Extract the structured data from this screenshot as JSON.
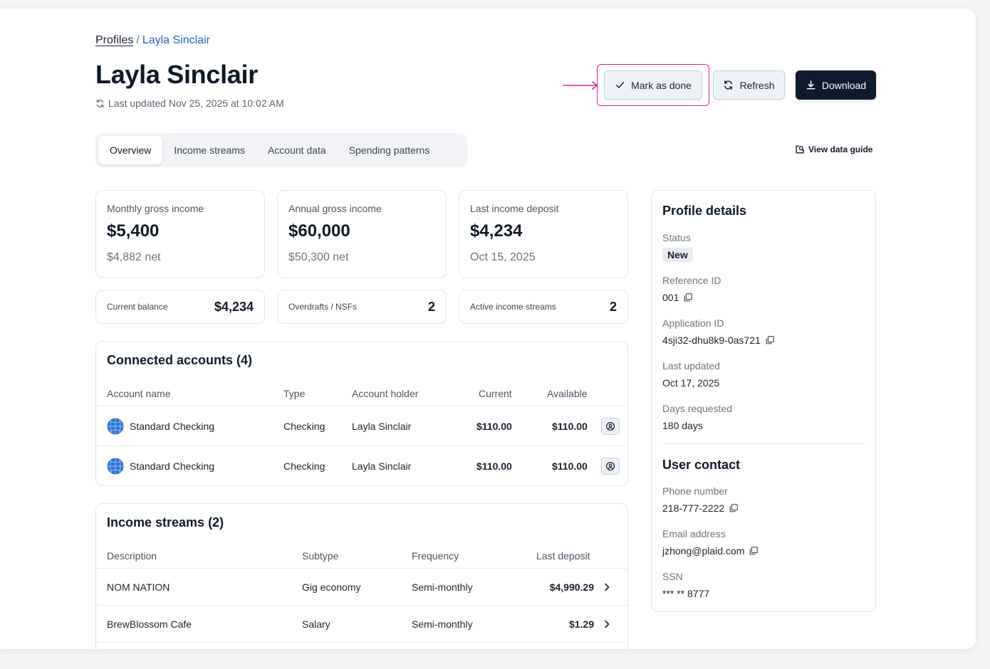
{
  "breadcrumb": {
    "root": "Profiles",
    "separator": "/",
    "current": "Layla Sinclair"
  },
  "header": {
    "title": "Layla Sinclair",
    "last_updated": "Last updated Nov 25, 2025 at 10:02 AM"
  },
  "actions": {
    "mark_done": "Mark as done",
    "refresh": "Refresh",
    "download": "Download"
  },
  "tabs": [
    {
      "label": "Overview",
      "active": true
    },
    {
      "label": "Income streams",
      "active": false
    },
    {
      "label": "Account data",
      "active": false
    },
    {
      "label": "Spending patterns",
      "active": false
    }
  ],
  "guide_link": "View data guide",
  "stats": [
    {
      "label": "Monthly gross income",
      "value": "$5,400",
      "sub": "$4,882 net"
    },
    {
      "label": "Annual gross income",
      "value": "$60,000",
      "sub": "$50,300 net"
    },
    {
      "label": "Last income deposit",
      "value": "$4,234",
      "sub": "Oct 15, 2025"
    }
  ],
  "mini_stats": [
    {
      "label": "Current balance",
      "value": "$4,234"
    },
    {
      "label": "Overdrafts / NSFs",
      "value": "2"
    },
    {
      "label": "Active income streams",
      "value": "2"
    }
  ],
  "accounts": {
    "title": "Connected accounts (4)",
    "columns": [
      "Account name",
      "Type",
      "Account holder",
      "Current",
      "Available"
    ],
    "rows": [
      {
        "name": "Standard Checking",
        "type": "Checking",
        "holder": "Layla Sinclair",
        "current": "$110.00",
        "available": "$110.00"
      },
      {
        "name": "Standard Checking",
        "type": "Checking",
        "holder": "Layla Sinclair",
        "current": "$110.00",
        "available": "$110.00"
      }
    ]
  },
  "income": {
    "title": "Income streams (2)",
    "columns": [
      "Description",
      "Subtype",
      "Frequency",
      "Last deposit"
    ],
    "rows": [
      {
        "description": "NOM NATION",
        "subtype": "Gig economy",
        "frequency": "Semi-monthly",
        "last_deposit": "$4,990.29"
      },
      {
        "description": "BrewBlossom Cafe",
        "subtype": "Salary",
        "frequency": "Semi-monthly",
        "last_deposit": "$1.29"
      }
    ]
  },
  "profile": {
    "title": "Profile details",
    "status_label": "Status",
    "status": "New",
    "ref_label": "Reference ID",
    "ref": "001",
    "app_label": "Application ID",
    "app": "4sji32-dhu8k9-0as721",
    "updated_label": "Last updated",
    "updated": "Oct 17, 2025",
    "days_label": "Days requested",
    "days": "180 days"
  },
  "contact": {
    "title": "User contact",
    "phone_label": "Phone number",
    "phone": "218-777-2222",
    "email_label": "Email address",
    "email": "jzhong@plaid.com",
    "ssn_label": "SSN",
    "ssn": "*** ** 8777"
  },
  "colors": {
    "accent": "#1f62c9",
    "primary_button": "#0e1a2e",
    "annotation": "#e0219a"
  }
}
